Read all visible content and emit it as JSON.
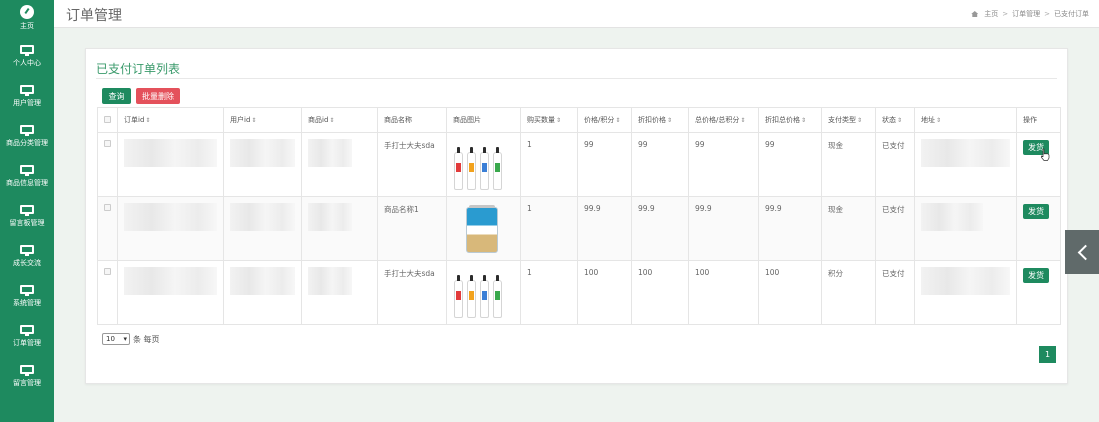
{
  "sidebar": {
    "items": [
      {
        "label": "主页",
        "icon": "dashboard-icon"
      },
      {
        "label": "个人中心",
        "icon": "monitor-icon"
      },
      {
        "label": "用户管理",
        "icon": "monitor-icon"
      },
      {
        "label": "商品分类管理",
        "icon": "monitor-icon"
      },
      {
        "label": "商品信息管理",
        "icon": "monitor-icon"
      },
      {
        "label": "留言板管理",
        "icon": "monitor-icon"
      },
      {
        "label": "成长交流",
        "icon": "monitor-icon"
      },
      {
        "label": "系统管理",
        "icon": "monitor-icon"
      },
      {
        "label": "订单管理",
        "icon": "monitor-icon"
      },
      {
        "label": "留言管理",
        "icon": "monitor-icon"
      }
    ]
  },
  "header": {
    "title": "订单管理",
    "breadcrumb": [
      "主页",
      "订单管理",
      "已支付订单"
    ]
  },
  "panel": {
    "title": "已支付订单列表",
    "search_label": "查询",
    "batch_delete_label": "批量删除"
  },
  "table": {
    "columns": [
      "订单id",
      "用户id",
      "商品id",
      "商品名称",
      "商品图片",
      "购买数量",
      "价格/积分",
      "折扣价格",
      "总价格/总积分",
      "折扣总价格",
      "支付类型",
      "状态",
      "地址",
      "操作"
    ],
    "rows": [
      {
        "name": "手打士大夫sda",
        "image": "milk-bottles",
        "qty": "1",
        "price": "99",
        "discount": "99",
        "total": "99",
        "discount_total": "99",
        "pay_type": "现金",
        "status": "已支付",
        "action": "发货"
      },
      {
        "name": "商品名称1",
        "image": "formula-can",
        "qty": "1",
        "price": "99.9",
        "discount": "99.9",
        "total": "99.9",
        "discount_total": "99.9",
        "pay_type": "现金",
        "status": "已支付",
        "action": "发货"
      },
      {
        "name": "手打士大夫sda",
        "image": "milk-bottles",
        "qty": "1",
        "price": "100",
        "discount": "100",
        "total": "100",
        "discount_total": "100",
        "pay_type": "积分",
        "status": "已支付",
        "action": "发货"
      }
    ]
  },
  "pagination": {
    "page_size": "10",
    "per_page_label": "条 每页",
    "current_page": "1"
  },
  "colors": {
    "primary": "#1e8a5f",
    "danger": "#e4515b",
    "title_green": "#3a9a6b"
  }
}
